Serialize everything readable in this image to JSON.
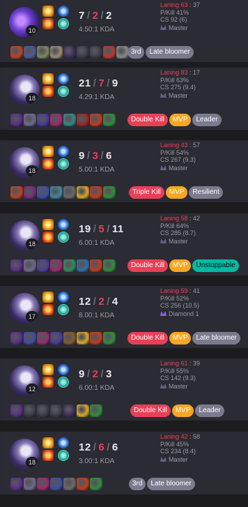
{
  "matches": [
    {
      "champ_style": "purple",
      "level": "10",
      "spells": [
        "flash",
        "ignite"
      ],
      "runes": [
        "blue",
        "cyan"
      ],
      "kills": "7",
      "deaths": "2",
      "assists": "2",
      "kda": "4.50:1 KDA",
      "laning_label": "Laning",
      "laning_a": "63",
      "laning_b": "37",
      "pkill": "P/Kill 41%",
      "cs": "CS 92 (6)",
      "tier": "Master",
      "tier_icon": "master",
      "items": [
        "#c0431f",
        "#4b5a9c",
        "#7c8a5a",
        "#9a8e6e",
        "#3b2d5a",
        "#3b3b47",
        "#3b3b47",
        "#b83a2c",
        "#8a8a8a"
      ],
      "badges": [
        {
          "text": "3rd",
          "style": "gray"
        },
        {
          "text": "Late bloomer",
          "style": "gray"
        }
      ]
    },
    {
      "champ_style": "",
      "level": "18",
      "spells": [
        "flash",
        "ignite"
      ],
      "runes": [
        "blue",
        "cyan"
      ],
      "kills": "21",
      "deaths": "7",
      "assists": "9",
      "kda": "4.29:1 KDA",
      "laning_label": "Laning",
      "laning_a": "83",
      "laning_b": "17",
      "pkill": "P/Kill 63%",
      "cs": "CS 275 (9.4)",
      "tier": "Master",
      "tier_icon": "master",
      "items": [
        "#5b2d8a",
        "#6f6a8c",
        "#4a3aa0",
        "#9c2a6a",
        "#2f8d8a",
        "#a0262a",
        "#c53b1b",
        "#2f8f3a"
      ],
      "badges": [
        {
          "text": "Double Kill",
          "style": "red"
        },
        {
          "text": "MVP",
          "style": "mvp"
        },
        {
          "text": "Leader",
          "style": "gray"
        }
      ]
    },
    {
      "champ_style": "",
      "level": "18",
      "spells": [
        "flash",
        "ignite"
      ],
      "runes": [
        "blue",
        "cyan"
      ],
      "kills": "9",
      "deaths": "3",
      "assists": "6",
      "kda": "5.00:1 KDA",
      "laning_label": "Laning",
      "laning_a": "43",
      "laning_b": "57",
      "pkill": "P/Kill 54%",
      "cs": "CS 267 (9.3)",
      "tier": "Master",
      "tier_icon": "master",
      "items": [
        "#c0431f",
        "#7a2a7a",
        "#3d4fa8",
        "#3a8a9c",
        "#6a6a6a",
        "#d8a820",
        "#c53b1b",
        "#2f8f3a"
      ],
      "badges": [
        {
          "text": "Triple Kill",
          "style": "red"
        },
        {
          "text": "MVP",
          "style": "mvp"
        },
        {
          "text": "Resilient",
          "style": "gray"
        }
      ]
    },
    {
      "champ_style": "",
      "level": "18",
      "spells": [
        "flash",
        "ignite"
      ],
      "runes": [
        "blue",
        "cyan"
      ],
      "kills": "19",
      "deaths": "5",
      "assists": "11",
      "kda": "6.00:1 KDA",
      "laning_label": "Laning",
      "laning_a": "58",
      "laning_b": "42",
      "pkill": "P/Kill 64%",
      "cs": "CS 285 (8.7)",
      "tier": "Master",
      "tier_icon": "master",
      "items": [
        "#5b2d8a",
        "#6f6a8c",
        "#4a3aa0",
        "#9c2a6a",
        "#2f8d5a",
        "#2f6fa8",
        "#c53b1b",
        "#2f8f3a"
      ],
      "badges": [
        {
          "text": "Double Kill",
          "style": "red"
        },
        {
          "text": "MVP",
          "style": "mvp"
        },
        {
          "text": "Unstoppable",
          "style": "green"
        }
      ]
    },
    {
      "champ_style": "",
      "level": "17",
      "spells": [
        "flash",
        "ignite"
      ],
      "runes": [
        "blue",
        "cyan"
      ],
      "kills": "12",
      "deaths": "2",
      "assists": "4",
      "kda": "8.00:1 KDA",
      "laning_label": "Laning",
      "laning_a": "59",
      "laning_b": "41",
      "pkill": "P/Kill 52%",
      "cs": "CS 256 (10.5)",
      "tier": "Diamond 1",
      "tier_icon": "diamond",
      "items": [
        "#5b2d8a",
        "#3d4fa8",
        "#9c2a6a",
        "#4a3aa0",
        "#8a5a2a",
        "#d8a820",
        "#c53b1b",
        "#2f8f3a"
      ],
      "badges": [
        {
          "text": "Double Kill",
          "style": "red"
        },
        {
          "text": "MVP",
          "style": "mvp"
        },
        {
          "text": "Late bloomer",
          "style": "gray"
        }
      ]
    },
    {
      "champ_style": "",
      "level": "12",
      "spells": [
        "flash",
        "ignite"
      ],
      "runes": [
        "blue",
        "cyan"
      ],
      "kills": "9",
      "deaths": "2",
      "assists": "3",
      "kda": "6.00:1 KDA",
      "laning_label": "Laning",
      "laning_a": "61",
      "laning_b": "39",
      "pkill": "P/Kill 55%",
      "cs": "CS 142 (9.3)",
      "tier": "Master",
      "tier_icon": "master",
      "items": [
        "#5b2d8a",
        "#3b3b47",
        "#3b3b47",
        "#3b3b47",
        "#3b2d5a",
        "#d8a820",
        "#2f8f3a"
      ],
      "badges": [
        {
          "text": "Double Kill",
          "style": "red"
        },
        {
          "text": "MVP",
          "style": "mvp"
        },
        {
          "text": "Leader",
          "style": "gray"
        }
      ]
    },
    {
      "champ_style": "",
      "level": "18",
      "spells": [
        "flash",
        "ignite"
      ],
      "runes": [
        "blue",
        "cyan"
      ],
      "kills": "12",
      "deaths": "6",
      "assists": "6",
      "kda": "3.00:1 KDA",
      "laning_label": "Laning",
      "laning_a": "42",
      "laning_b": "58",
      "pkill": "P/Kill 45%",
      "cs": "CS 234 (8.4)",
      "tier": "Master",
      "tier_icon": "master",
      "items": [
        "#5b2d8a",
        "#6f6a8c",
        "#9c2a6a",
        "#3d4fa8",
        "#6a6a6a",
        "#c53b1b",
        "#2f8f3a"
      ],
      "badges": [
        {
          "text": "3rd",
          "style": "gray"
        },
        {
          "text": "Late bloomer",
          "style": "gray"
        }
      ]
    }
  ]
}
